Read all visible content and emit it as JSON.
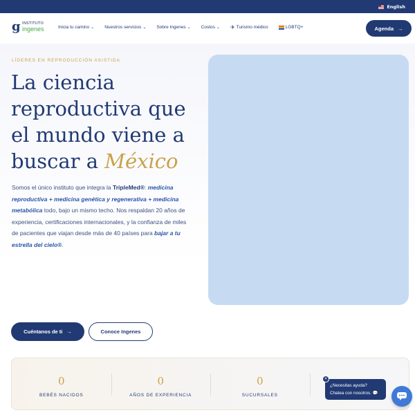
{
  "topbar": {
    "language_label": "English",
    "flag_icon": "us-flag-icon"
  },
  "nav": {
    "logo_top": "INSTITUTO",
    "logo_bottom": "ingenes",
    "items": [
      {
        "label": "Inicia tu camino",
        "has_dropdown": true
      },
      {
        "label": "Nuestros servicios",
        "has_dropdown": true
      },
      {
        "label": "Sobre Ingenes",
        "has_dropdown": true
      },
      {
        "label": "Costos",
        "has_dropdown": true
      },
      {
        "label": "Turismo médico",
        "icon": "plane-icon"
      },
      {
        "label": "LGBTQ+",
        "icon": "rainbow-flag-icon"
      }
    ],
    "cta_label": "Agenda"
  },
  "hero": {
    "eyebrow": "LÍDERES EN REPRODUCCIÓN ASISTIDA",
    "headline_plain": "La ciencia reproductiva que el mundo viene a buscar a",
    "headline_accent": "México",
    "body": {
      "p1": "Somos el único instituto que integra la ",
      "brand": "TripleMed®",
      "p2": ": ",
      "medicine": "medicina reproductiva + medicina genética y regenerativa + medicina metabólica",
      "p3": " todo, bajo un mismo techo. Nos respaldan 20 años de experiencia, certificaciones internacionales, y la confianza de miles de pacientes que viajan desde más de 40 países para ",
      "slogan": "bajar a tu estrella del cielo®",
      "p4": "."
    },
    "primary_cta": "Cuéntanos de ti",
    "secondary_cta": "Conoce Ingenes"
  },
  "stats": [
    {
      "value": "0",
      "label": "BEBÉS NACIDOS"
    },
    {
      "value": "0",
      "label": "AÑOS DE EXPERIENCIA"
    },
    {
      "value": "0",
      "label": "SUCURSALES"
    },
    {
      "value": "0",
      "label": ""
    }
  ],
  "chat": {
    "line1": "¿Necesitas ayuda?",
    "line2": "Chatea con nosotros."
  },
  "colors": {
    "primary": "#213a74",
    "accent": "#c9a24a",
    "image_placeholder": "#c6dbf2"
  }
}
